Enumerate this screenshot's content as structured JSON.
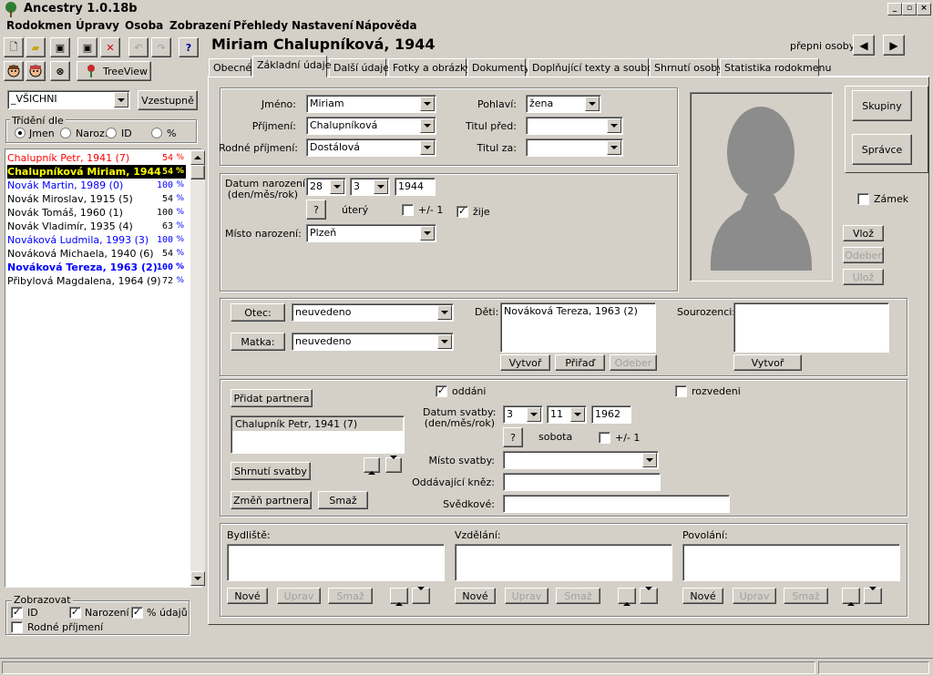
{
  "app": {
    "title": "Ancestry 1.0.18b"
  },
  "menu": [
    "Rodokmen",
    "Úpravy",
    "Osoba",
    "Zobrazení",
    "Přehledy",
    "Nastavení",
    "Nápověda"
  ],
  "left": {
    "treeview_label": "TreeView",
    "filter_value": "_VŠICHNI",
    "sort_button": "Vzestupně",
    "sort_group": "Třídění dle",
    "sort_options": [
      "Jmen",
      "Naroz.",
      "ID",
      "%"
    ],
    "persons": [
      {
        "name": "Chalupník Petr, 1941 (7)",
        "pct": "54",
        "color": "#ff0000",
        "bold": false,
        "selected": false
      },
      {
        "name": "Chalupníková Miriam, 1944",
        "pct": "54",
        "color": "#ffff00",
        "bold": true,
        "selected": true
      },
      {
        "name": "Novák Martin, 1989 (0)",
        "pct": "100",
        "color": "#0000ff",
        "bold": false,
        "selected": false
      },
      {
        "name": "Novák Miroslav, 1915 (5)",
        "pct": "54",
        "color": "#000000",
        "bold": false,
        "selected": false
      },
      {
        "name": "Novák Tomáš, 1960 (1)",
        "pct": "100",
        "color": "#000000",
        "bold": false,
        "selected": false
      },
      {
        "name": "Novák Vladimír, 1935 (4)",
        "pct": "63",
        "color": "#000000",
        "bold": false,
        "selected": false
      },
      {
        "name": "Nováková Ludmila, 1993 (3)",
        "pct": "100",
        "color": "#0000ff",
        "bold": false,
        "selected": false
      },
      {
        "name": "Nováková Michaela, 1940 (6)",
        "pct": "54",
        "color": "#000000",
        "bold": false,
        "selected": false
      },
      {
        "name": "Nováková Tereza, 1963 (2)",
        "pct": "100",
        "color": "#0000ff",
        "bold": true,
        "selected": false
      },
      {
        "name": "Přibylová Magdalena, 1964 (9)",
        "pct": "72",
        "color": "#000000",
        "bold": false,
        "selected": false
      }
    ],
    "pct_sign": "%",
    "display_group": "Zobrazovat",
    "display_id": "ID",
    "display_birth": "Narození",
    "display_pct": "% údajů",
    "display_rodne": "Rodné příjmení"
  },
  "header": {
    "person_title": "Miriam Chalupníková, 1944",
    "switch_label": "přepni osoby"
  },
  "tabs": [
    "Obecné",
    "Základní údaje",
    "Další údaje",
    "Fotky a obrázky",
    "Dokumenty",
    "Doplňující texty a soubory",
    "Shrnutí osoby",
    "Statistika rodokmenu"
  ],
  "basic": {
    "jmeno_label": "Jméno:",
    "jmeno": "Miriam",
    "prijmeni_label": "Příjmení:",
    "prijmeni": "Chalupníková",
    "rodne_label": "Rodné příjmení:",
    "rodne": "Dostálová",
    "pohlavi_label": "Pohlaví:",
    "pohlavi": "žena",
    "titul_pred_label": "Titul před:",
    "titul_pred": "",
    "titul_za_label": "Titul za:",
    "titul_za": ""
  },
  "birth": {
    "label": "Datum narození:",
    "label2": "(den/měs/rok)",
    "day": "28",
    "month": "3",
    "year": "1944",
    "q": "?",
    "weekday": "úterý",
    "pm1": "+/- 1",
    "alive": "žije",
    "place_label": "Místo narození:",
    "place": "Plzeň"
  },
  "side": {
    "groups": "Skupiny",
    "admin": "Správce",
    "lock": "Zámek",
    "insert": "Vlož",
    "remove": "Odeber",
    "save": "Ulož"
  },
  "family": {
    "father_btn": "Otec:",
    "father": "neuvedeno",
    "mother_btn": "Matka:",
    "mother": "neuvedeno",
    "children_label": "Děti:",
    "children": [
      "Nováková Tereza, 1963 (2)"
    ],
    "create": "Vytvoř",
    "assign": "Přiřaď",
    "remove": "Odeber",
    "siblings_label": "Sourozenci:",
    "sib_create": "Vytvoř"
  },
  "marriage": {
    "add_partner": "Přidat partnera",
    "partners": [
      "Chalupník Petr, 1941 (7)"
    ],
    "summary": "Shrnutí svatby",
    "change": "Změň partnera",
    "delete": "Smaž",
    "married": "oddáni",
    "divorced": "rozvedeni",
    "date_label": "Datum svatby:",
    "date_label2": "(den/měs/rok)",
    "day": "3",
    "month": "11",
    "year": "1962",
    "q": "?",
    "weekday": "sobota",
    "pm1": "+/- 1",
    "place_label": "Místo svatby:",
    "priest_label": "Oddávající kněz:",
    "witness_label": "Svědkové:"
  },
  "bottom": {
    "residence": "Bydliště:",
    "education": "Vzdělání:",
    "occupation": "Povolání:",
    "new": "Nové",
    "edit": "Uprav",
    "delete": "Smaž"
  }
}
